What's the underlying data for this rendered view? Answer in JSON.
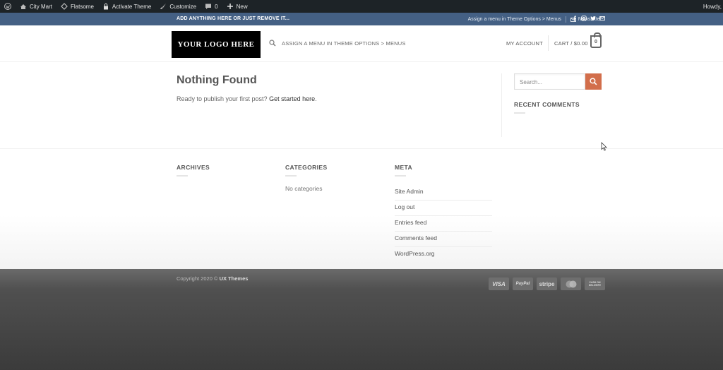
{
  "adminbar": {
    "site": "City Mart",
    "theme": "Flatsome",
    "activate": "Activate Theme",
    "customize": "Customize",
    "comments": "0",
    "new": "New",
    "howdy": "Howdy, "
  },
  "topbar": {
    "left_text": "ADD ANYTHING HERE OR JUST REMOVE IT...",
    "menu_text": "Assign a menu in Theme Options > Menus",
    "newsletter": "Newsletter"
  },
  "header": {
    "logo": "YOUR LOGO HERE",
    "menu": "ASSIGN A MENU IN THEME OPTIONS > MENUS",
    "account": "MY ACCOUNT",
    "cart": "CART / $0.00",
    "cart_count": "0"
  },
  "main": {
    "title": "Nothing Found",
    "intro": "Ready to publish your first post? ",
    "intro_link": "Get started here",
    "intro_end": "."
  },
  "sidebar": {
    "search_placeholder": "Search...",
    "recent_comments": "RECENT COMMENTS"
  },
  "footer": {
    "archives": "ARCHIVES",
    "categories": "CATEGORIES",
    "no_categories": "No categories",
    "meta": "META",
    "meta_items": [
      "Site Admin",
      "Log out",
      "Entries feed",
      "Comments feed",
      "WordPress.org"
    ],
    "copyright": "Copyright 2020 © ",
    "copyright_brand": "UX Themes",
    "payments": [
      "VISA",
      "PayPal",
      "stripe",
      "MasterCard",
      "CASH ON DELIVERY"
    ]
  },
  "colors": {
    "adminbar": "#1d2327",
    "topbar": "#446084",
    "accent": "#d26e4b",
    "footer": "#444444"
  }
}
